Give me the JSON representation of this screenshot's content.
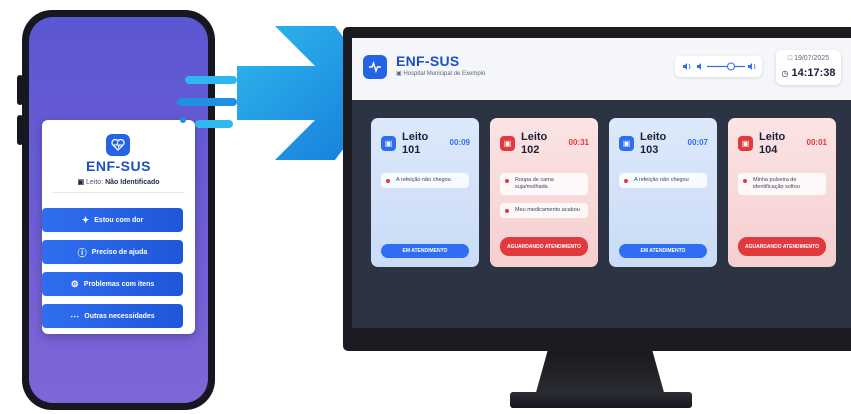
{
  "phone": {
    "app_title": "ENF-SUS",
    "bed_label": "Leito:",
    "bed_value": "Não Identificado",
    "buttons": [
      {
        "label": "Estou com dor",
        "icon": "pain-icon"
      },
      {
        "label": "Preciso de ajuda",
        "icon": "help-icon"
      },
      {
        "label": "Problemas com itens",
        "icon": "box-icon"
      },
      {
        "label": "Outras necessidades",
        "icon": "dots-icon"
      }
    ]
  },
  "monitor": {
    "app_title": "ENF-SUS",
    "hospital": "Hospital Municipal de Exemplo",
    "date": "19/07/2025",
    "time": "14:17:38",
    "colors": {
      "blue": "#2f6ef0",
      "red": "#e2393f"
    },
    "cards": [
      {
        "leito": "Leito",
        "number": "101",
        "timer": "00:09",
        "status": "blue",
        "requests": [
          "A refeição não chegou"
        ],
        "action": "EM ATENDIMENTO"
      },
      {
        "leito": "Leito",
        "number": "102",
        "timer": "00:31",
        "status": "red",
        "requests": [
          "Roupa de cama suja/molhada",
          "Meu medicamento acabou"
        ],
        "action": "AGUARDANDO ATENDIMENTO"
      },
      {
        "leito": "Leito",
        "number": "103",
        "timer": "00:07",
        "status": "blue",
        "requests": [
          "A refeição não chegou"
        ],
        "action": "EM ATENDIMENTO"
      },
      {
        "leito": "Leito",
        "number": "104",
        "timer": "00:01",
        "status": "red",
        "requests": [
          "Minha pulseira de identificação soltou"
        ],
        "action": "AGUARDANDO ATENDIMENTO"
      }
    ]
  }
}
